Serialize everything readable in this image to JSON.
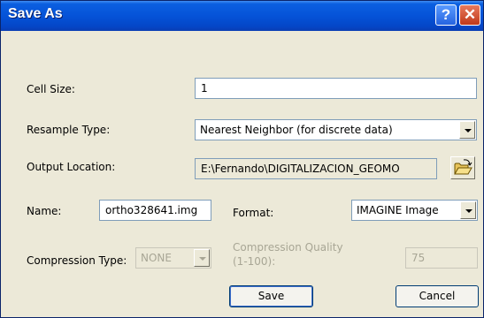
{
  "window": {
    "title": "Save As",
    "help_glyph": "?",
    "close_glyph": "✕"
  },
  "fields": {
    "cell_size": {
      "label": "Cell Size:",
      "value": "1"
    },
    "resample_type": {
      "label": "Resample Type:",
      "value": "Nearest Neighbor (for discrete data)"
    },
    "output_location": {
      "label": "Output Location:",
      "value": "E:\\Fernando\\DIGITALIZACION_GEOMO"
    },
    "name": {
      "label": "Name:",
      "value": "ortho328641.img"
    },
    "format": {
      "label": "Format:",
      "value": "IMAGINE Image"
    },
    "compression_type": {
      "label": "Compression Type:",
      "value": "NONE"
    },
    "compression_quality": {
      "label_line1": "Compression Quality",
      "label_line2": "(1-100):",
      "value": "75"
    }
  },
  "buttons": {
    "save": "Save",
    "cancel": "Cancel"
  },
  "icons": {
    "browse": "open-folder-icon"
  }
}
